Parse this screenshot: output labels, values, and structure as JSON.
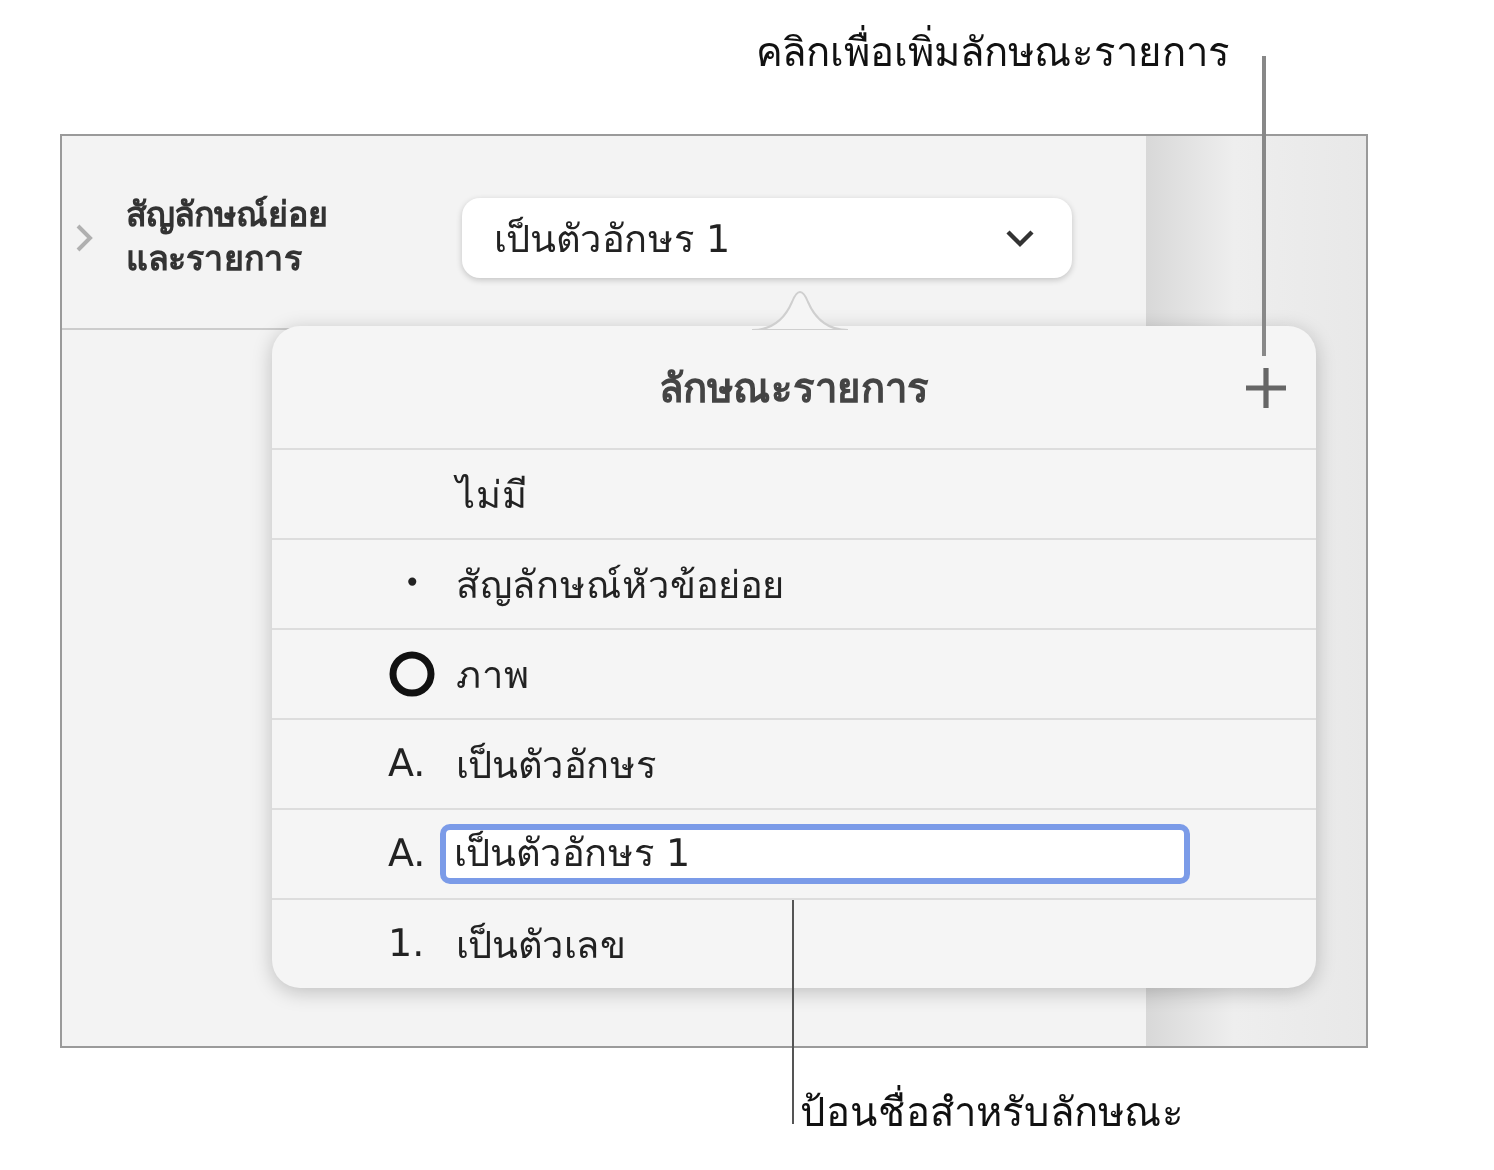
{
  "callouts": [
    {
      "text": "คลิกเพื่อเพิ่มลักษณะรายการ"
    },
    {
      "text": "ป้อนชื่อสำหรับลักษณะ"
    }
  ],
  "section": {
    "label_lines": [
      "สัญลักษณ์ย่อย",
      "และรายการ"
    ],
    "expanded": false,
    "popup_value": "เป็นตัวอักษร 1"
  },
  "popover": {
    "title": "ลักษณะรายการ",
    "items": [
      {
        "kind": "none",
        "label": "ไม่มี",
        "editing": false
      },
      {
        "kind": "bullet",
        "marker": "•",
        "label": "สัญลักษณ์หัวข้อย่อย",
        "editing": false
      },
      {
        "kind": "image",
        "label": "ภาพ",
        "editing": false
      },
      {
        "kind": "text",
        "marker": "A.",
        "label": "เป็นตัวอักษร",
        "editing": false
      },
      {
        "kind": "text",
        "marker": "A.",
        "label": "เป็นตัวอักษร 1",
        "editing": true
      },
      {
        "kind": "text",
        "marker": "1.",
        "label": "เป็นตัวเลข",
        "editing": false
      }
    ]
  }
}
